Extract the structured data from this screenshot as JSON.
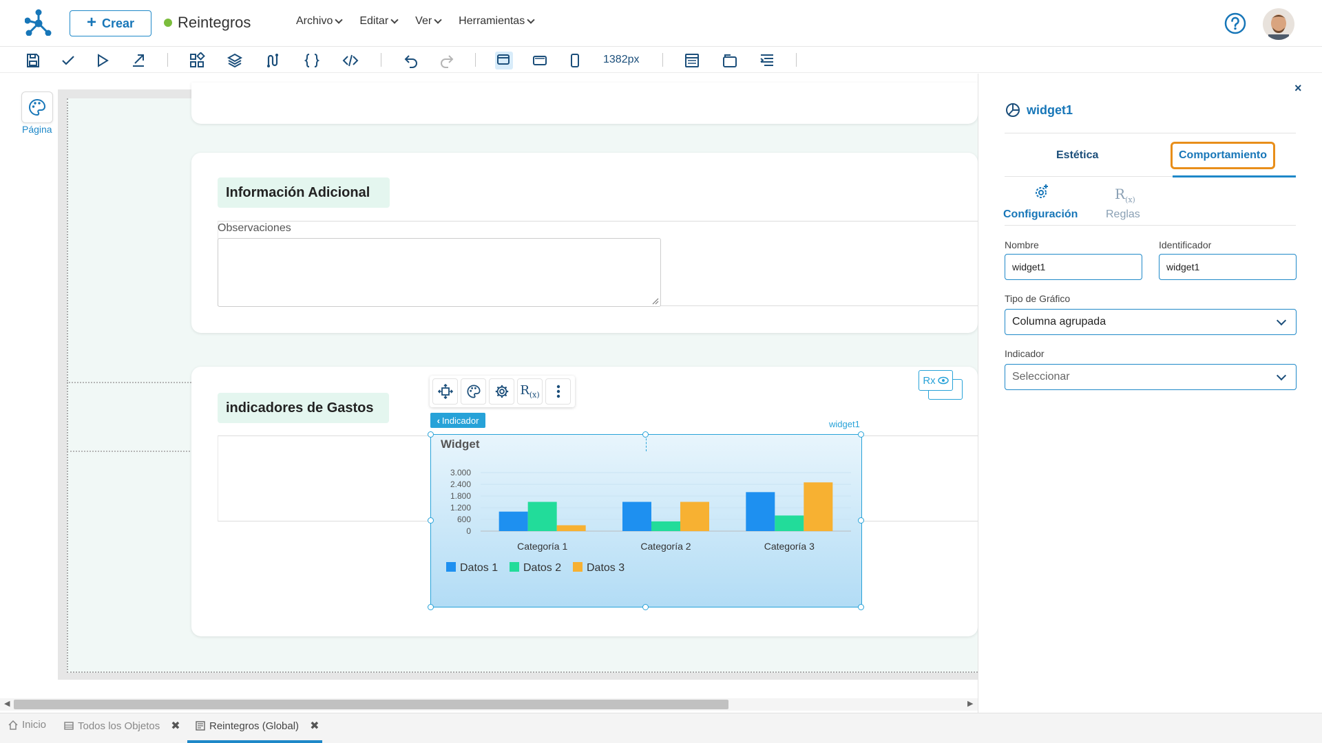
{
  "header": {
    "create_label": "Crear",
    "doc_title": "Reintegros",
    "menu": [
      {
        "label": "Archivo"
      },
      {
        "label": "Editar"
      },
      {
        "label": "Ver"
      },
      {
        "label": "Herramientas"
      }
    ],
    "status_color": "#7bbd3c"
  },
  "toolbar": {
    "width_label": "1382px",
    "icons": [
      "save-icon",
      "check-icon",
      "play-icon",
      "export-icon",
      "components-icon",
      "layers-icon",
      "workflow-icon",
      "braces-icon",
      "code-icon",
      "undo-icon",
      "redo-icon",
      "desktop-icon",
      "tablet-icon",
      "mobile-icon",
      "layout-icon",
      "window-icon",
      "align-icon"
    ]
  },
  "canvas": {
    "page_label": "Página",
    "section1_title": "Información Adicional",
    "observaciones_label": "Observaciones",
    "section2_title": "indicadores de Gastos",
    "indicator_badge": "Indicador",
    "widget_name_tag": "widget1",
    "rx_label": "Rx"
  },
  "widget": {
    "title": "Widget"
  },
  "chart_data": {
    "type": "bar",
    "title": "Widget",
    "categories": [
      "Categoría 1",
      "Categoría 2",
      "Categoría 3"
    ],
    "series": [
      {
        "name": "Datos 1",
        "values": [
          1000,
          1500,
          2000
        ],
        "color": "#1e90f0"
      },
      {
        "name": "Datos 2",
        "values": [
          1500,
          500,
          800
        ],
        "color": "#22dc9a"
      },
      {
        "name": "Datos 3",
        "values": [
          300,
          1500,
          2500
        ],
        "color": "#f7b132"
      }
    ],
    "yticks": [
      "3.000",
      "2.400",
      "1.800",
      "1.200",
      "600",
      "0"
    ],
    "ylim": [
      0,
      3000
    ],
    "legend_position": "bottom-left"
  },
  "panel": {
    "title": "widget1",
    "tab_estetica": "Estética",
    "tab_comportamiento": "Comportamiento",
    "subtab_configuracion": "Configuración",
    "subtab_reglas": "Reglas",
    "nombre_label": "Nombre",
    "nombre_value": "widget1",
    "identificador_label": "Identificador",
    "identificador_value": "widget1",
    "tipo_grafico_label": "Tipo de Gráfico",
    "tipo_grafico_value": "Columna agrupada",
    "indicador_label": "Indicador",
    "indicador_placeholder": "Seleccionar",
    "accent_color": "#1e88c8",
    "highlight_color": "#e88e1a"
  },
  "bottom_tabs": [
    {
      "label": "Inicio",
      "icon": "home-icon"
    },
    {
      "label": "Todos los Objetos",
      "icon": "list-icon"
    },
    {
      "label": "Reintegros (Global)",
      "icon": "form-icon"
    }
  ]
}
